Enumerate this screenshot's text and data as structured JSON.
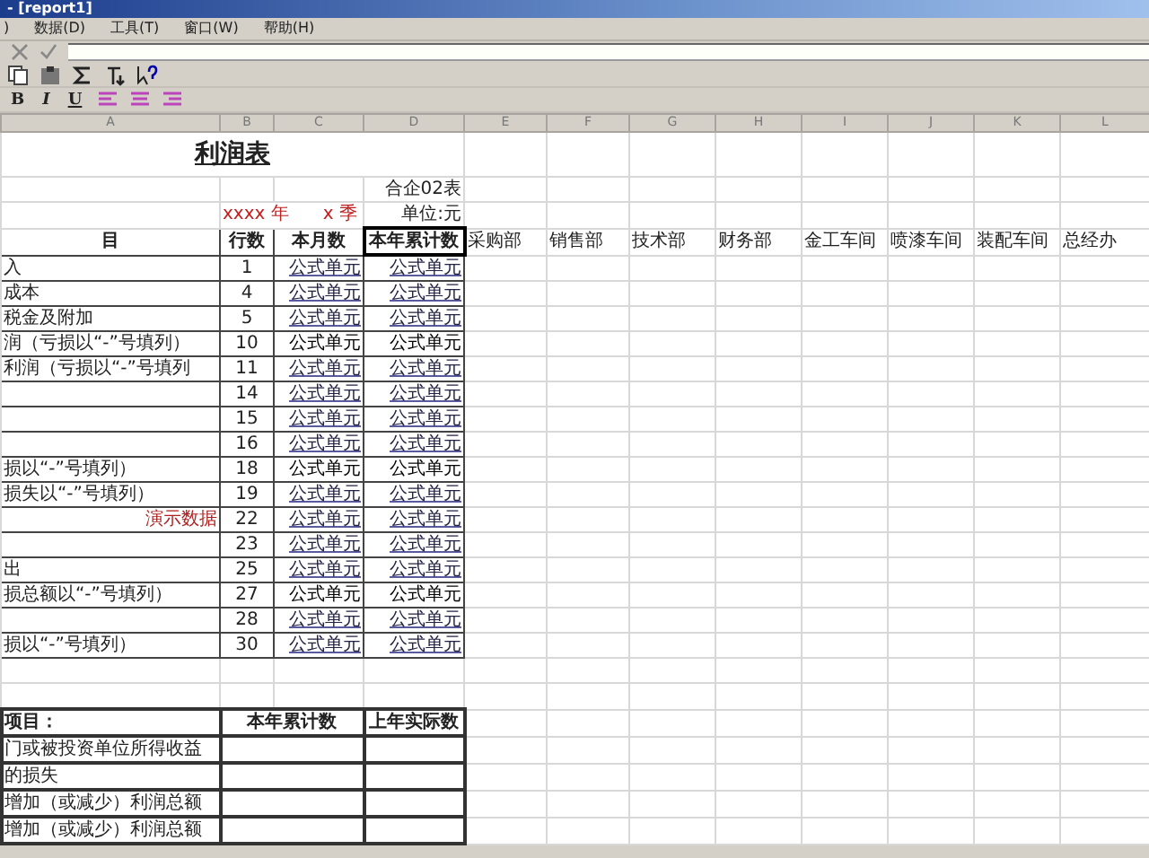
{
  "window": {
    "title": "- [report1]"
  },
  "menu": [
    ")",
    "数据(D)",
    "工具(T)",
    "窗口(W)",
    "帮助(H)"
  ],
  "format_buttons": [
    "B",
    "I",
    "U"
  ],
  "columns": [
    "A",
    "B",
    "C",
    "D",
    "E",
    "F",
    "G",
    "H",
    "I",
    "J",
    "K",
    "L"
  ],
  "report": {
    "title": "利润表",
    "form_no": "合企02表",
    "unit": "单位:元",
    "year": "xxxx 年",
    "quarter": "x 季",
    "headers": [
      "目",
      "行数",
      "本月数",
      "本年累计数"
    ],
    "departments": [
      "采购部",
      "销售部",
      "技术部",
      "财务部",
      "金工车间",
      "喷漆车间",
      "装配车间",
      "总经办"
    ],
    "rows": [
      {
        "item": "入",
        "line": "1",
        "month": "公式单元",
        "year": "公式单元",
        "kind": "link"
      },
      {
        "item": "成本",
        "line": "4",
        "month": "公式单元",
        "year": "公式单元",
        "kind": "link"
      },
      {
        "item": "税金及附加",
        "line": "5",
        "month": "公式单元",
        "year": "公式单元",
        "kind": "link"
      },
      {
        "item": "润（亏损以“-”号填列）",
        "line": "10",
        "month": "公式单元",
        "year": "公式单元",
        "kind": "total"
      },
      {
        "item": "利润（亏损以“-”号填列",
        "line": "11",
        "month": "公式单元",
        "year": "公式单元",
        "kind": "link"
      },
      {
        "item": "",
        "line": "14",
        "month": "公式单元",
        "year": "公式单元",
        "kind": "link"
      },
      {
        "item": "",
        "line": "15",
        "month": "公式单元",
        "year": "公式单元",
        "kind": "link"
      },
      {
        "item": "",
        "line": "16",
        "month": "公式单元",
        "year": "公式单元",
        "kind": "link"
      },
      {
        "item": "损以“-”号填列）",
        "line": "18",
        "month": "公式单元",
        "year": "公式单元",
        "kind": "total"
      },
      {
        "item": "损失以“-”号填列）",
        "line": "19",
        "month": "公式单元",
        "year": "公式单元",
        "kind": "link"
      },
      {
        "item": "",
        "line": "22",
        "month": "公式单元",
        "year": "公式单元",
        "kind": "link"
      },
      {
        "item": "",
        "line": "23",
        "month": "公式单元",
        "year": "公式单元",
        "kind": "link"
      },
      {
        "item": "出",
        "line": "25",
        "month": "公式单元",
        "year": "公式单元",
        "kind": "link"
      },
      {
        "item": "损总额以“-”号填列）",
        "line": "27",
        "month": "公式单元",
        "year": "公式单元",
        "kind": "total"
      },
      {
        "item": "",
        "line": "28",
        "month": "公式单元",
        "year": "公式单元",
        "kind": "link"
      },
      {
        "item": "损以“-”号填列）",
        "line": "30",
        "month": "公式单元",
        "year": "公式单元",
        "kind": "link"
      }
    ],
    "demo_stamp": "演示数据"
  },
  "supplement": {
    "headers": [
      "项目：",
      "本年累计数",
      "上年实际数"
    ],
    "rows": [
      "门或被投资单位所得收益",
      "的损失",
      "增加（或减少）利润总额",
      "增加（或减少）利润总额"
    ]
  }
}
